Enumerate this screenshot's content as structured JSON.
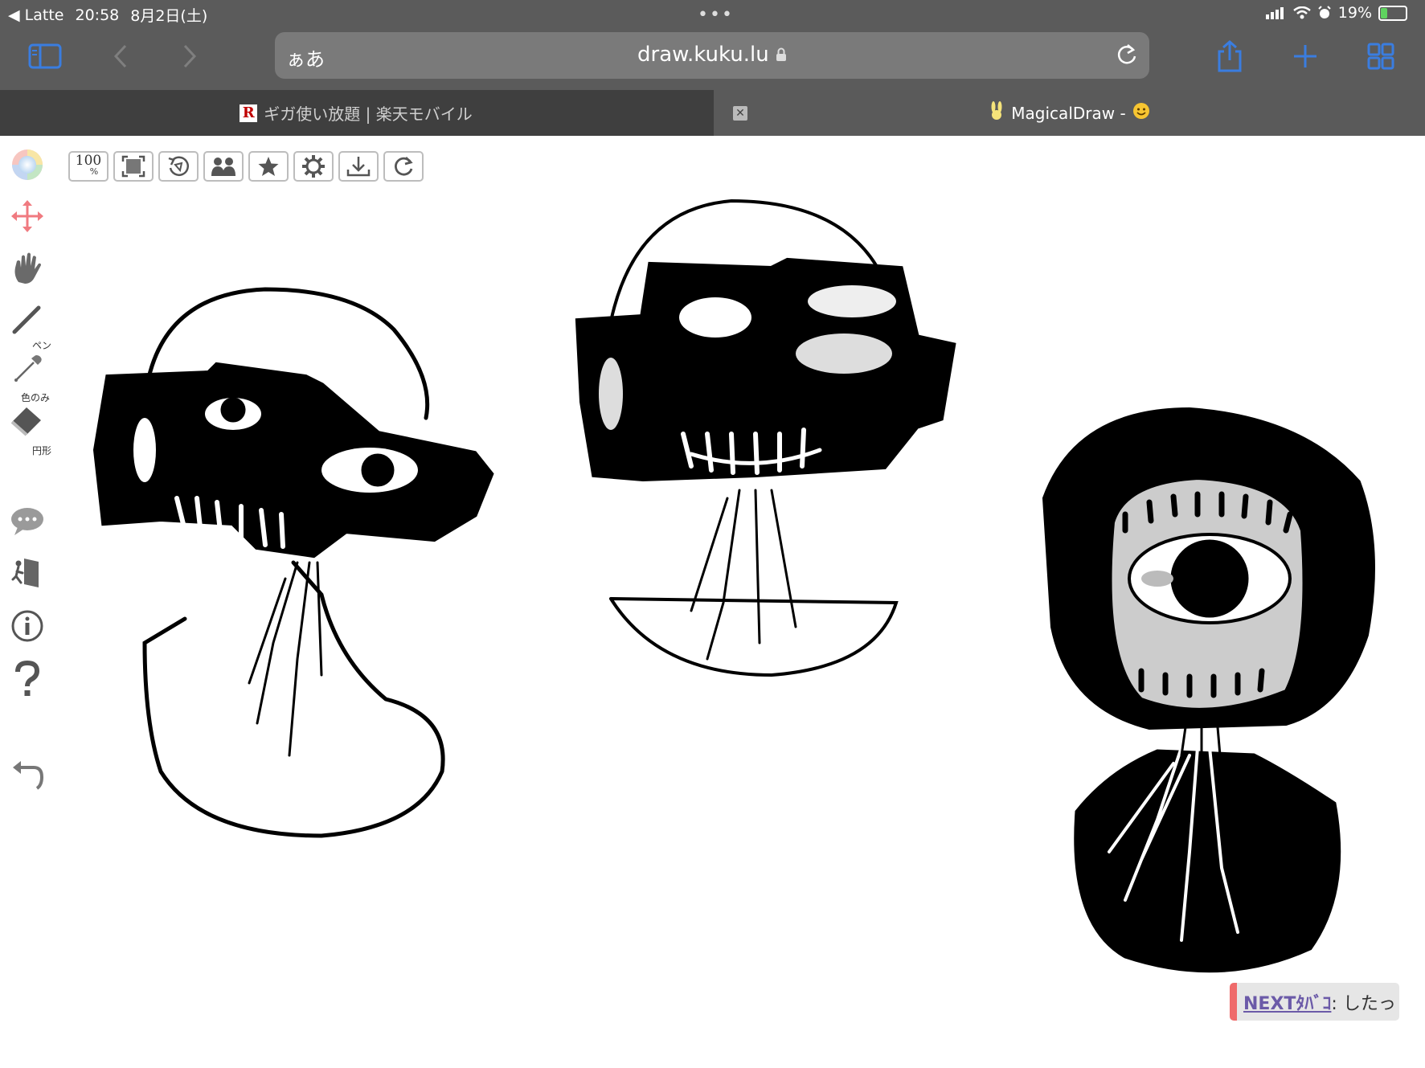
{
  "status": {
    "back_app": "Latte",
    "time": "20:58",
    "date": "8月2日(土)",
    "battery": "19%",
    "dots": "•••"
  },
  "browser": {
    "aa": "ぁあ",
    "url": "draw.kuku.lu",
    "tabs": [
      {
        "title": "ギガ使い放題 | 楽天モバイル",
        "icon_letter": "R"
      },
      {
        "title": "MagicalDraw -",
        "icon": "rabbit-icon"
      }
    ],
    "accent": "#3a7de0"
  },
  "toolbar": {
    "zoom_value": "100",
    "zoom_unit": "%"
  },
  "sidebar": {
    "pen_label": "ペン",
    "picker_label": "色のみ",
    "eraser_label": "円形"
  },
  "footer": {
    "next_link": "NEXTﾀﾊﾞｺ",
    "next_text": ": したっ"
  },
  "colors": {
    "chrome": "#5b5b5b",
    "tabbar": "#3f3f3f",
    "active_tab": "#5a5a5a",
    "next_border": "#ef6a6a"
  }
}
